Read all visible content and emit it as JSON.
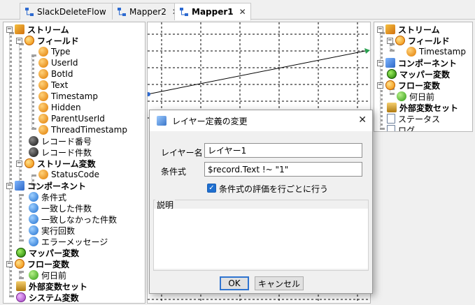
{
  "tabs": [
    {
      "label": "SlackDeleteFlow",
      "close": "✕",
      "active": false
    },
    {
      "label": "Mapper2",
      "close": "✕",
      "active": false
    },
    {
      "label": "Mapper1",
      "close": "✕",
      "active": true
    }
  ],
  "left_tree": {
    "stream": "ストリーム",
    "fields": "フィールド",
    "field_items": [
      "Type",
      "UserId",
      "BotId",
      "Text",
      "Timestamp",
      "Hidden",
      "ParentUserId",
      "ThreadTimestamp"
    ],
    "record_no": "レコード番号",
    "record_count": "レコード件数",
    "stream_vars": "ストリーム変数",
    "status_code": "StatusCode",
    "component": "コンポーネント",
    "comp_items": [
      "条件式",
      "一致した件数",
      "一致しなかった件数",
      "実行回数",
      "エラーメッセージ"
    ],
    "mapper_vars": "マッパー変数",
    "flow_vars": "フロー変数",
    "nanka": "何日前",
    "ext_vars": "外部変数セット",
    "sys_vars": "システム変数"
  },
  "right_tree": {
    "stream": "ストリーム",
    "fields": "フィールド",
    "timestamp": "Timestamp",
    "component": "コンポーネント",
    "mapper_vars": "マッパー変数",
    "flow_vars": "フロー変数",
    "nanka": "何日前",
    "ext_vars": "外部変数セット",
    "status": "ステータス",
    "log": "ログ"
  },
  "dialog": {
    "title": "レイヤー定義の変更",
    "close": "✕",
    "layer_name_label": "レイヤー名",
    "layer_name_value": "レイヤー1",
    "condition_label": "条件式",
    "condition_value": "$record.Text !~ \"1\"",
    "eval_per_row_label": "条件式の評価を行ごとに行う",
    "eval_per_row_checked": true,
    "description_label": "説明",
    "description_value": "",
    "ok_label": "OK",
    "cancel_label": "キャンセル"
  }
}
